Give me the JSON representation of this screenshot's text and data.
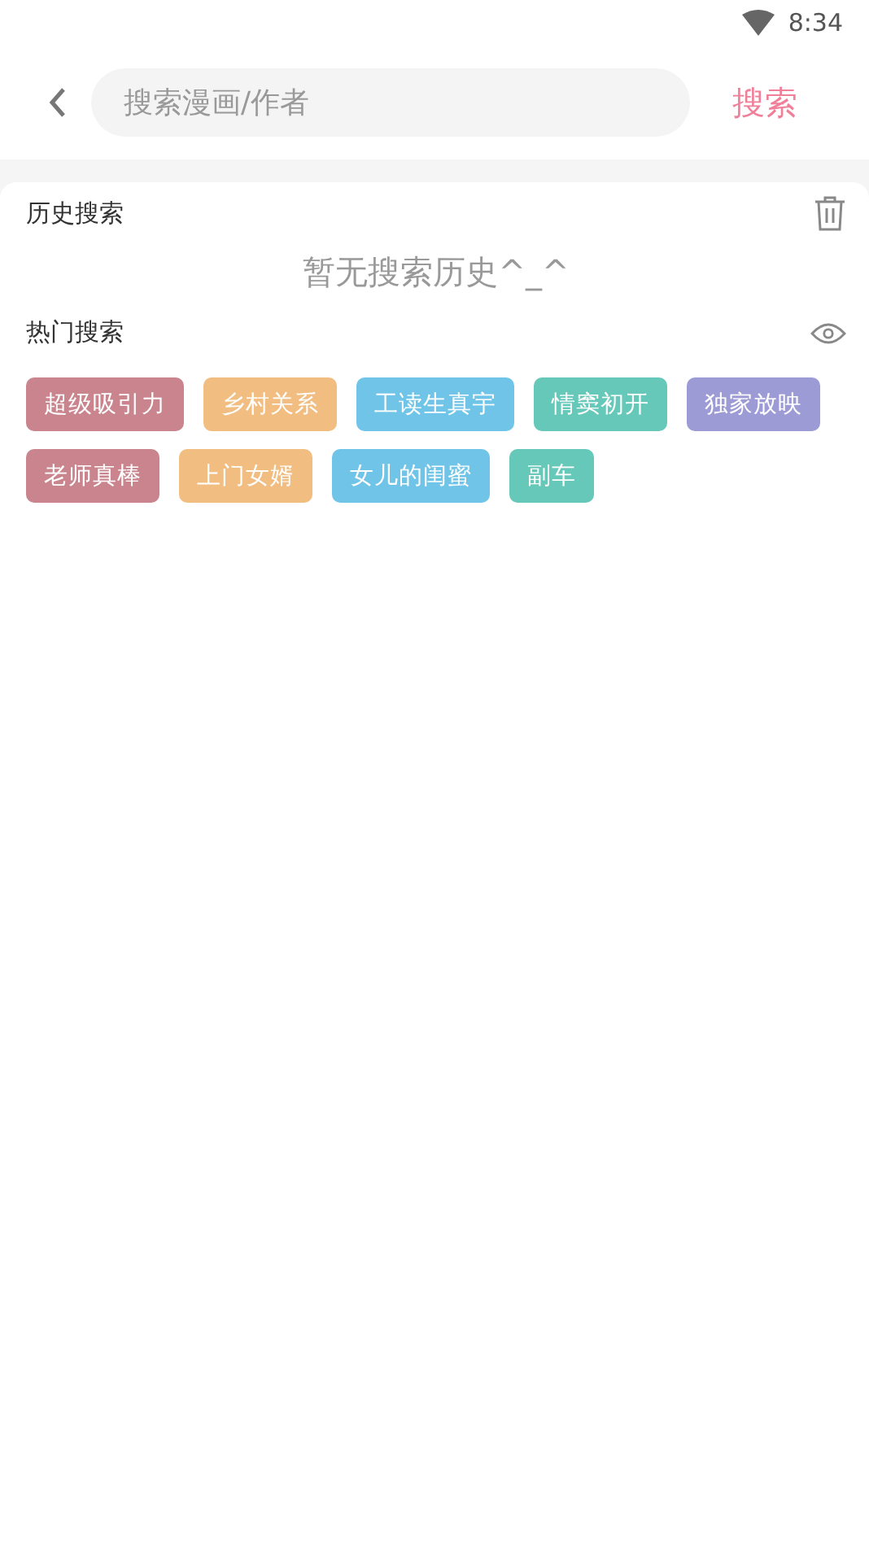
{
  "status_bar": {
    "time": "8:34"
  },
  "search": {
    "placeholder": "搜索漫画/作者",
    "button": "搜索"
  },
  "history": {
    "title": "历史搜索",
    "empty_text": "暂无搜索历史^_^"
  },
  "hot": {
    "title": "热门搜索",
    "tags": [
      {
        "label": "超级吸引力",
        "color": "#c9848d"
      },
      {
        "label": "乡村关系",
        "color": "#f2bd80"
      },
      {
        "label": "工读生真宇",
        "color": "#70c4e8"
      },
      {
        "label": "情窦初开",
        "color": "#65c8b8"
      },
      {
        "label": "独家放映",
        "color": "#9d9bd6"
      },
      {
        "label": "老师真棒",
        "color": "#c9848d"
      },
      {
        "label": "上门女婿",
        "color": "#f2bd80"
      },
      {
        "label": "女儿的闺蜜",
        "color": "#70c4e8"
      },
      {
        "label": "副车",
        "color": "#65c8b8"
      }
    ]
  }
}
